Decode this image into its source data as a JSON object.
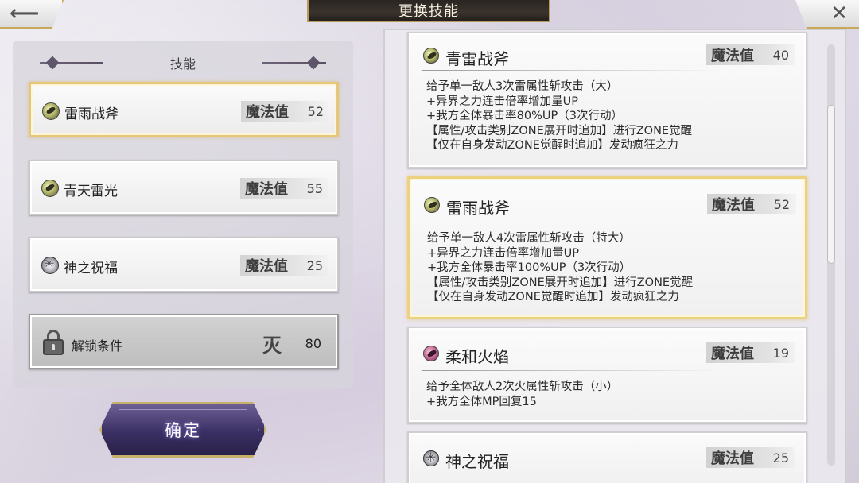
{
  "window": {
    "title": "更换技能"
  },
  "nav": {
    "back_glyph": "⟵",
    "close_glyph": "✕"
  },
  "left": {
    "header": "技能",
    "slots": [
      {
        "name": "雷雨战斧",
        "mp_label": "魔法值",
        "mp": "52",
        "icon": "thunder-icon"
      },
      {
        "name": "青天雷光",
        "mp_label": "魔法值",
        "mp": "55",
        "icon": "thunder-icon"
      },
      {
        "name": "神之祝福",
        "mp_label": "魔法值",
        "mp": "25",
        "icon": "blessing-icon"
      }
    ],
    "unlock": {
      "label": "解锁条件",
      "rank_glyph": "灭",
      "value": "80"
    },
    "confirm_label": "确定"
  },
  "right": {
    "cards": [
      {
        "name": "青雷战斧",
        "mp_label": "魔法值",
        "mp": "40",
        "icon": "thunder-icon",
        "description": "给予单一敌人3次雷属性斩攻击（大）\n+异界之力连击倍率增加量UP\n+我方全体暴击率80%UP（3次行动）\n【属性/攻击类别ZONE展开时追加】进行ZONE觉醒\n【仅在自身发动ZONE觉醒时追加】发动疯狂之力"
      },
      {
        "name": "雷雨战斧",
        "mp_label": "魔法值",
        "mp": "52",
        "icon": "thunder-icon",
        "description": "给予单一敌人4次雷属性斩攻击（特大）\n+异界之力连击倍率增加量UP\n+我方全体暴击率100%UP（3次行动）\n【属性/攻击类别ZONE展开时追加】进行ZONE觉醒\n【仅在自身发动ZONE觉醒时追加】发动疯狂之力"
      },
      {
        "name": "柔和火焰",
        "mp_label": "魔法值",
        "mp": "19",
        "icon": "fire-icon",
        "description": "给予全体敌人2次火属性斩攻击（小）\n+我方全体MP回复15"
      },
      {
        "name": "神之祝福",
        "mp_label": "魔法值",
        "mp": "25",
        "icon": "blessing-icon",
        "description": ""
      }
    ]
  },
  "colors": {
    "accent_gold": "#e6c77a",
    "button_purple": "#3a2f63"
  }
}
